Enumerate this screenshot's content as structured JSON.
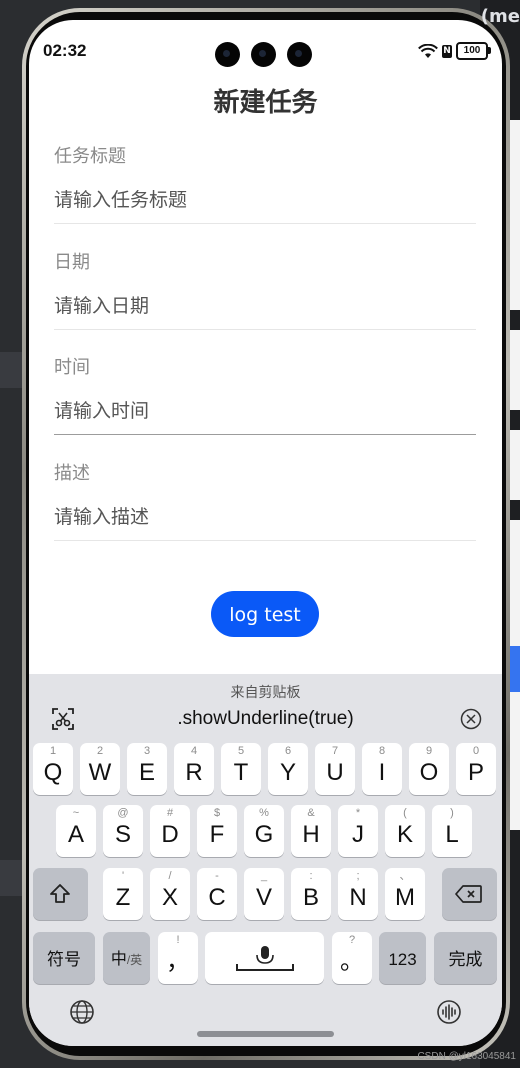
{
  "status_bar": {
    "time": "02:32",
    "nfc": "N",
    "battery": "100"
  },
  "app": {
    "title": "新建任务",
    "fields": [
      {
        "label": "任务标题",
        "placeholder": "请输入任务标题"
      },
      {
        "label": "日期",
        "placeholder": "请输入日期"
      },
      {
        "label": "时间",
        "placeholder": "请输入时间"
      },
      {
        "label": "描述",
        "placeholder": "请输入描述"
      }
    ],
    "log_button": "log test"
  },
  "keyboard": {
    "clipboard_title": "来自剪贴板",
    "clipboard_text": ".showUnderline(true)",
    "row1": [
      {
        "main": "Q",
        "sub": "1"
      },
      {
        "main": "W",
        "sub": "2"
      },
      {
        "main": "E",
        "sub": "3"
      },
      {
        "main": "R",
        "sub": "4"
      },
      {
        "main": "T",
        "sub": "5"
      },
      {
        "main": "Y",
        "sub": "6"
      },
      {
        "main": "U",
        "sub": "7"
      },
      {
        "main": "I",
        "sub": "8"
      },
      {
        "main": "O",
        "sub": "9"
      },
      {
        "main": "P",
        "sub": "0"
      }
    ],
    "row2": [
      {
        "main": "A",
        "sub": "~"
      },
      {
        "main": "S",
        "sub": "@"
      },
      {
        "main": "D",
        "sub": "#"
      },
      {
        "main": "F",
        "sub": "$"
      },
      {
        "main": "G",
        "sub": "%"
      },
      {
        "main": "H",
        "sub": "&"
      },
      {
        "main": "J",
        "sub": "*"
      },
      {
        "main": "K",
        "sub": "("
      },
      {
        "main": "L",
        "sub": ")"
      }
    ],
    "row3": [
      {
        "main": "Z",
        "sub": "'"
      },
      {
        "main": "X",
        "sub": "/"
      },
      {
        "main": "C",
        "sub": "-"
      },
      {
        "main": "V",
        "sub": "_"
      },
      {
        "main": "B",
        "sub": ":"
      },
      {
        "main": "N",
        "sub": ";"
      },
      {
        "main": "M",
        "sub": "、"
      }
    ],
    "symbols_key": "符号",
    "lang_key_main": "中",
    "lang_key_sub": "/英",
    "comma_key": "，",
    "comma_sub": "!",
    "period_key": "。",
    "period_sub": "?",
    "num_key": "123",
    "done_key": "完成"
  },
  "colors": {
    "accent": "#0a59f7",
    "keyboard_bg": "#e2e3e7",
    "dark_key": "#bdc0c7"
  },
  "watermark": "CSDN @yl163045841"
}
